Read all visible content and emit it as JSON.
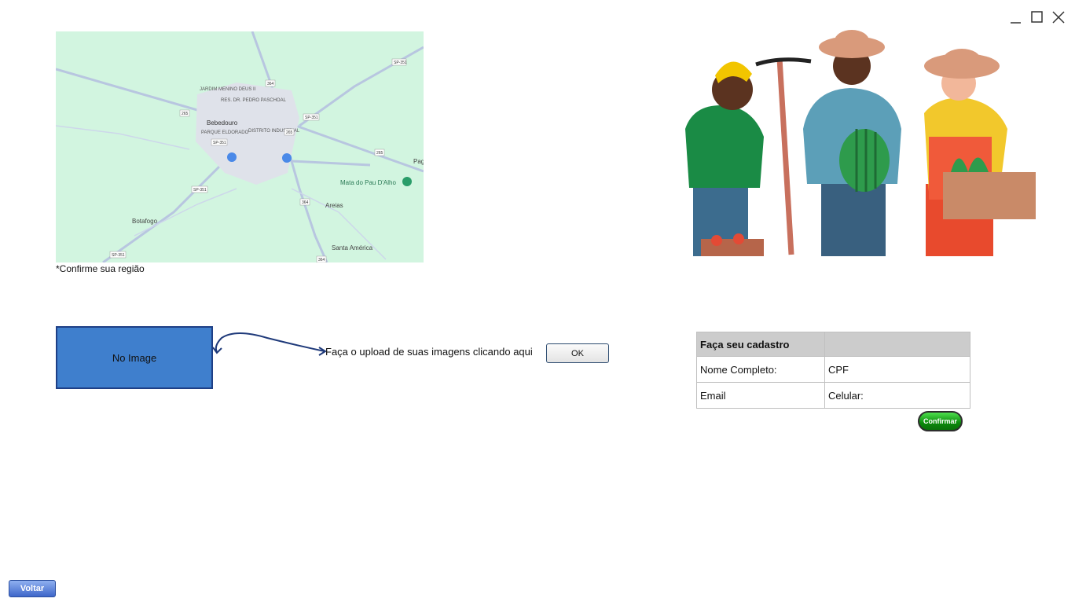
{
  "window": {
    "minimize_icon": "minimize-icon",
    "maximize_icon": "maximize-icon",
    "close_icon": "close-icon"
  },
  "map": {
    "labels": {
      "jardim": "JARDIM MENINO DEUS II",
      "res": "RES. DR. PEDRO PASCHOAL",
      "bebedouro": "Bebedouro",
      "parque": "PARQUE ELDORADO",
      "distrito": "DISTRITO INDUSTRIAL",
      "mata": "Mata do Pau D'Alho",
      "areias": "Areias",
      "botafogo": "Botafogo",
      "santa": "Santa América",
      "pag": "Pag"
    },
    "shields": {
      "s1": "SP-351",
      "s2": "364",
      "s3": "265",
      "s4": "SP-351",
      "s5": "265",
      "s6": "SP-351",
      "s7": "265",
      "s8": "SP-351",
      "s9": "364",
      "s10": "SP-351",
      "s11": "364"
    },
    "caption": "*Confirme sua região"
  },
  "upload": {
    "placeholder": "No Image",
    "instruction": "Faça o upload de suas imagens clicando aqui",
    "ok_label": "OK"
  },
  "form": {
    "title": "Faça seu cadastro",
    "full_name_label": "Nome Completo:",
    "cpf_label": "CPF",
    "email_label": "Email",
    "phone_label": "Celular:",
    "confirm_label": "Confirmar"
  },
  "footer": {
    "back_label": "Voltar"
  },
  "colors": {
    "map_bg": "#d2f5e0",
    "placeholder_bg": "#3f7fcd",
    "confirm_green": "#0b8a0b",
    "back_blue": "#3e66c9"
  }
}
